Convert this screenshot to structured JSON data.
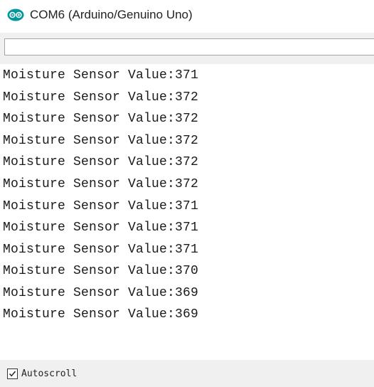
{
  "window": {
    "title": "COM6 (Arduino/Genuino Uno)",
    "app_icon": "arduino-icon",
    "accent_color": "#00979c"
  },
  "send": {
    "value": "",
    "placeholder": ""
  },
  "serial_output": {
    "lines": [
      "Moisture Sensor Value:371",
      "Moisture Sensor Value:372",
      "Moisture Sensor Value:372",
      "Moisture Sensor Value:372",
      "Moisture Sensor Value:372",
      "Moisture Sensor Value:372",
      "Moisture Sensor Value:371",
      "Moisture Sensor Value:371",
      "Moisture Sensor Value:371",
      "Moisture Sensor Value:370",
      "Moisture Sensor Value:369",
      "Moisture Sensor Value:369"
    ]
  },
  "footer": {
    "autoscroll_label": "Autoscroll",
    "autoscroll_checked": true
  }
}
